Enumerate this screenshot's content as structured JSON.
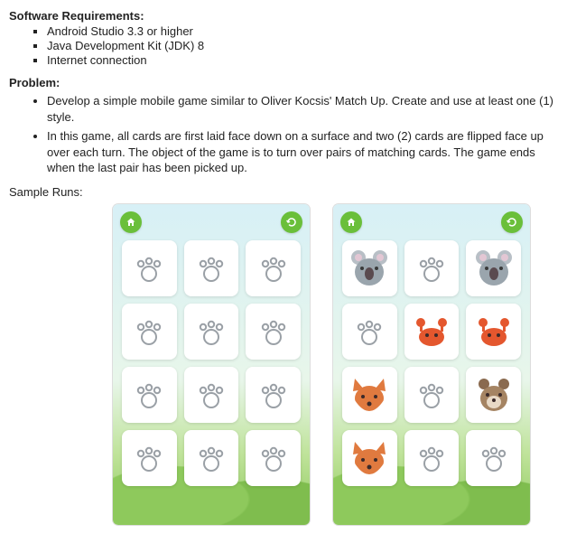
{
  "headings": {
    "software_requirements": "Software Requirements:",
    "problem": "Problem:",
    "sample_runs": "Sample Runs:"
  },
  "software_requirements": [
    "Android Studio 3.3 or higher",
    "Java Development Kit (JDK) 8",
    "Internet connection"
  ],
  "problem_items": [
    "Develop a simple mobile game similar to Oliver Kocsis' Match Up. Create and use at least one (1) style.",
    "In this game, all cards are first laid face down on a surface and two (2) cards are flipped face up over each turn. The object of the game is to turn over pairs of matching cards. The game ends when the last pair has been picked up."
  ],
  "screens": [
    {
      "cards": [
        "back",
        "back",
        "back",
        "back",
        "back",
        "back",
        "back",
        "back",
        "back",
        "back",
        "back",
        "back"
      ]
    },
    {
      "cards": [
        "koala",
        "back",
        "koala",
        "back",
        "crab",
        "crab",
        "fox",
        "back",
        "bear",
        "fox",
        "back",
        "back"
      ]
    }
  ],
  "icons": {
    "home": "home-icon",
    "refresh": "refresh-icon",
    "card_back": "paw-icon"
  }
}
